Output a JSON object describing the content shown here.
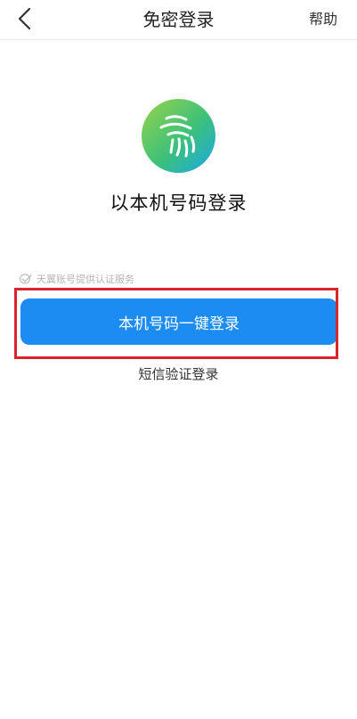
{
  "header": {
    "title": "免密登录",
    "help_label": "帮助"
  },
  "main": {
    "headline": "以本机号码登录",
    "provider_note": "天翼账号提供认证服务",
    "primary_button_label": "本机号码一键登录",
    "sms_login_label": "短信验证登录"
  },
  "colors": {
    "primary": "#1c8cf2",
    "highlight": "#d9232d",
    "logo_green": "#8fd14a",
    "logo_blue": "#1ab0e6"
  },
  "icons": {
    "back": "chevron-left-icon",
    "logo": "fingerprint-logo-icon",
    "provider": "check-mark-icon"
  }
}
